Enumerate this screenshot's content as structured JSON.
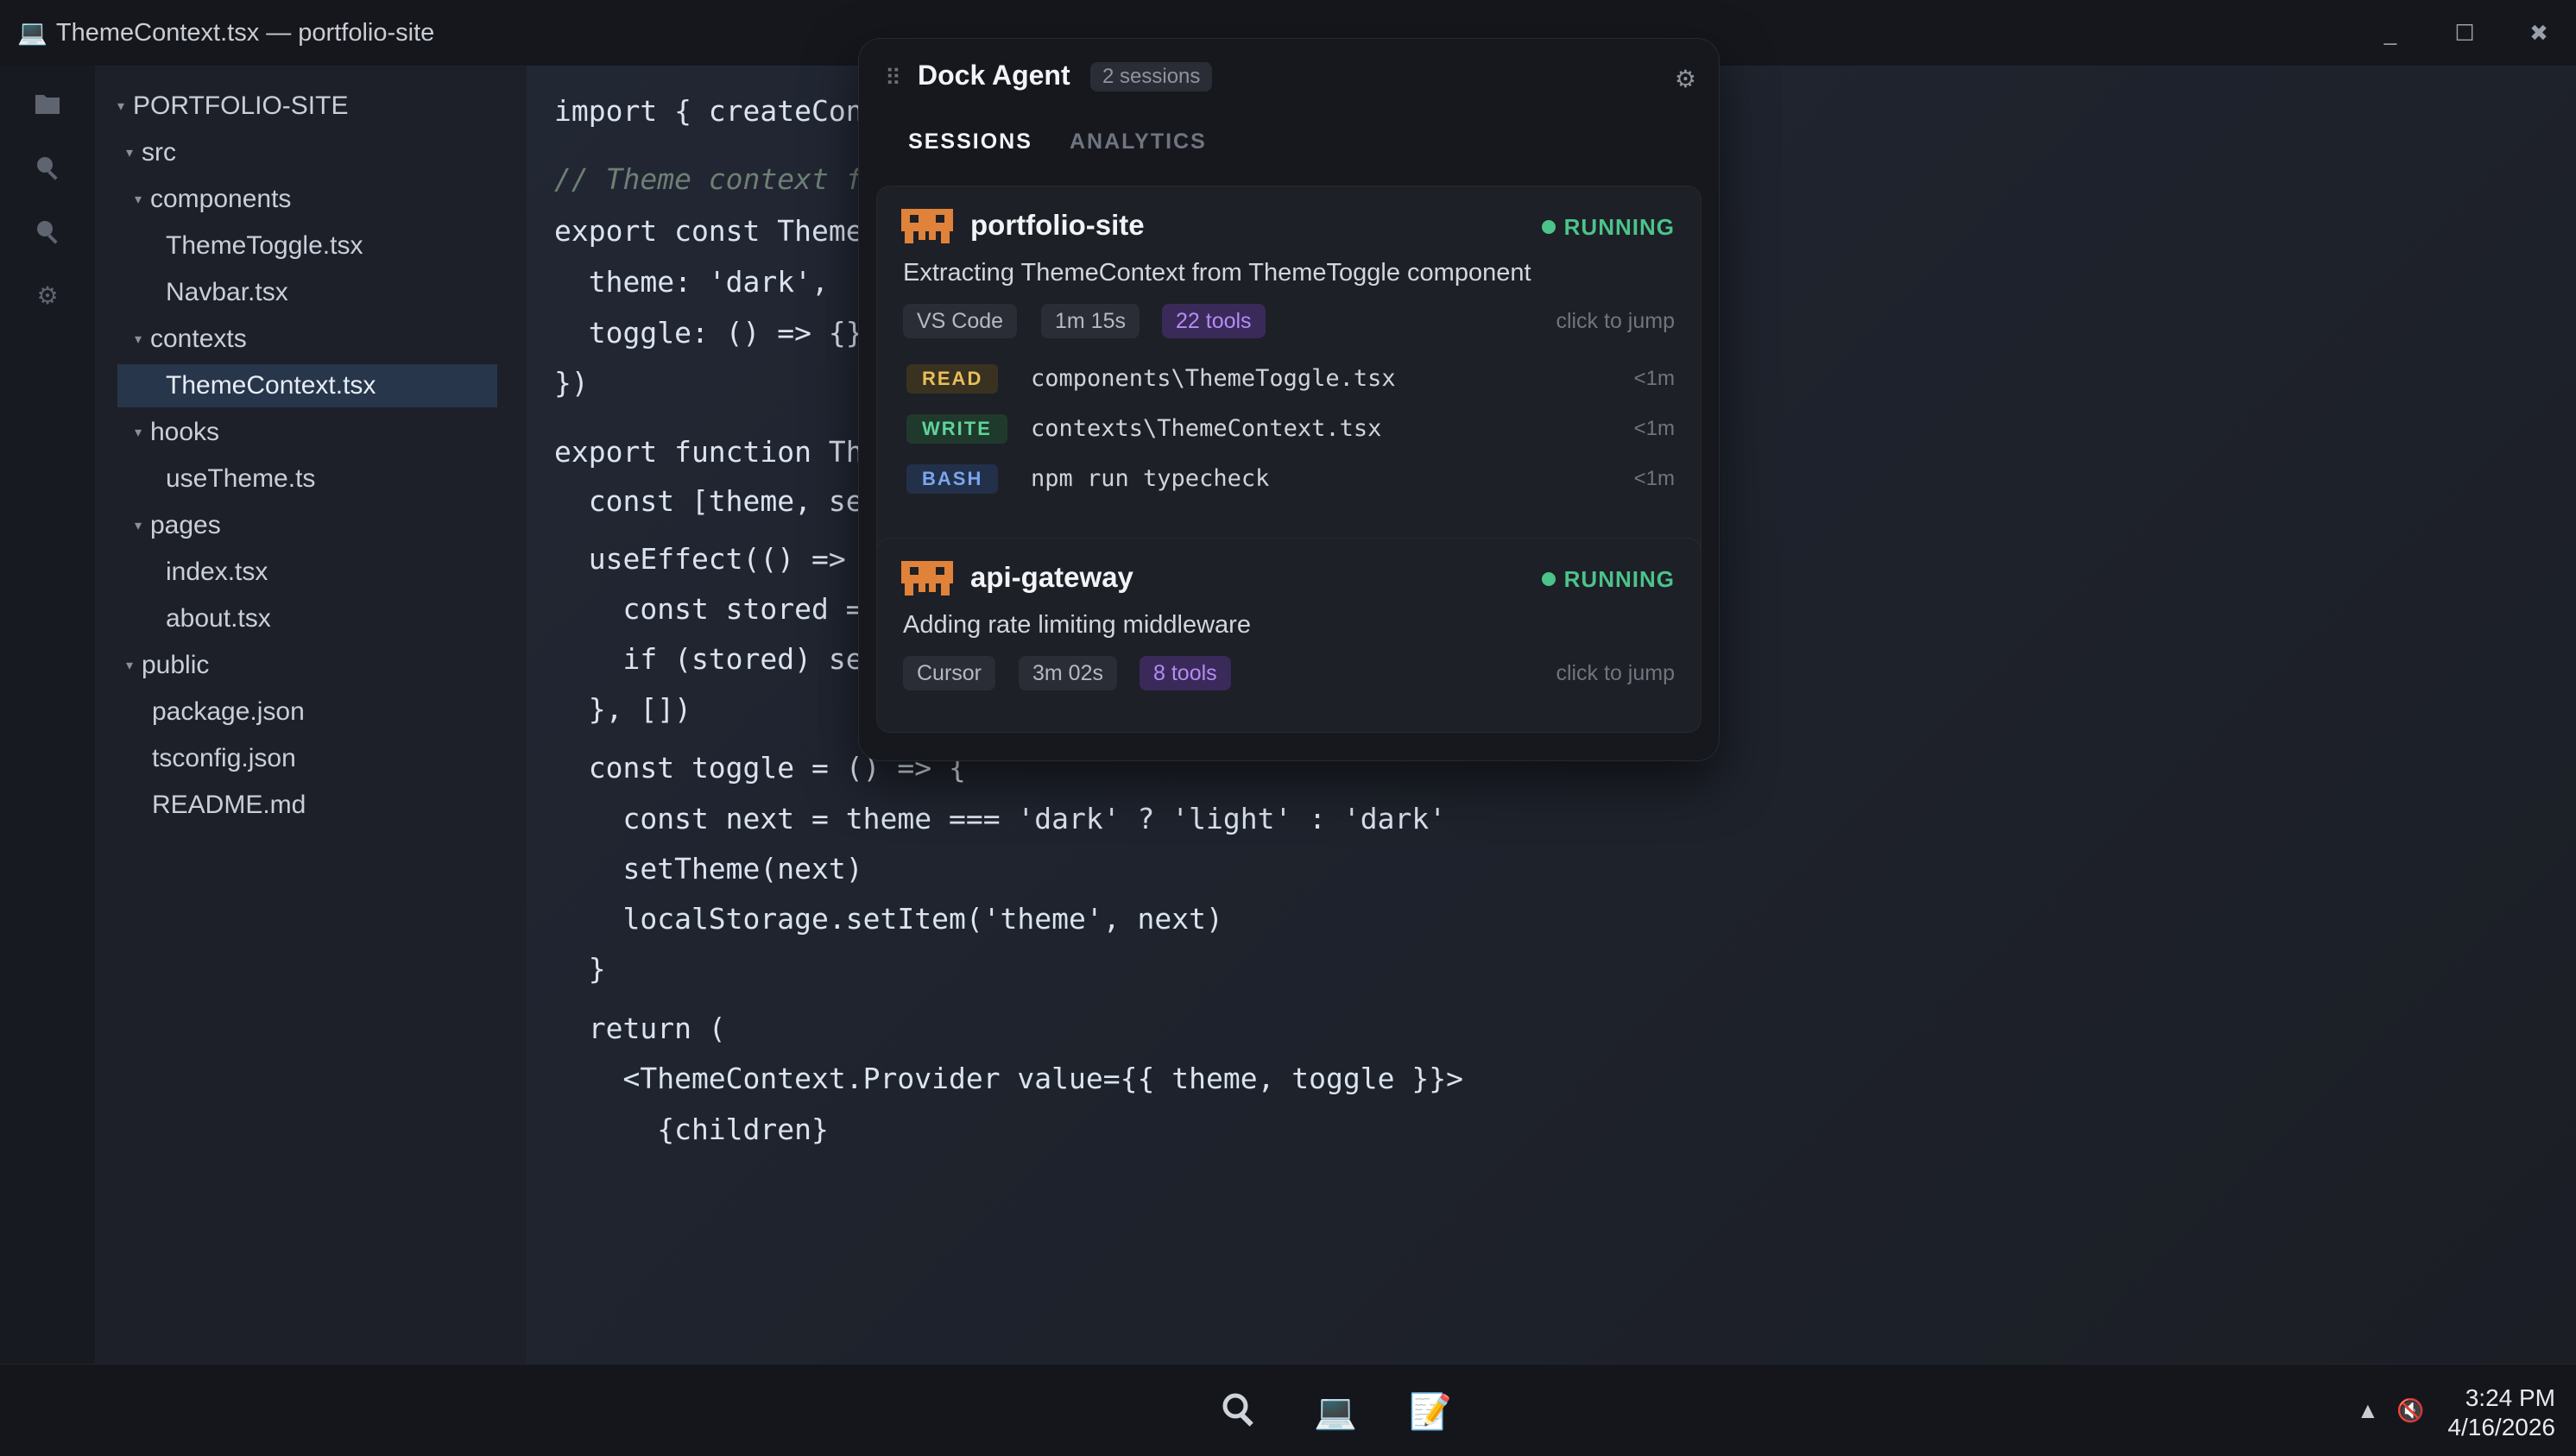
{
  "window": {
    "title": "ThemeContext.tsx — portfolio-site",
    "icon": "terminal-icon",
    "controls": [
      "_",
      "☐",
      "✖"
    ]
  },
  "activity_bar": [
    "files-icon",
    "search-icon",
    "search-icon",
    "gear-icon"
  ],
  "explorer": {
    "root": "PORTFOLIO-SITE",
    "items": [
      {
        "label": "src"
      },
      {
        "label": "components"
      },
      {
        "label": "ThemeToggle.tsx"
      },
      {
        "label": "Navbar.tsx"
      },
      {
        "label": "contexts"
      },
      {
        "label": "ThemeContext.tsx"
      },
      {
        "label": "hooks"
      },
      {
        "label": "useTheme.ts"
      },
      {
        "label": "pages"
      },
      {
        "label": "index.tsx"
      },
      {
        "label": "about.tsx"
      },
      {
        "label": "public"
      },
      {
        "label": "package.json"
      },
      {
        "label": "tsconfig.json"
      },
      {
        "label": "README.md"
      }
    ],
    "selected": "ThemeContext.tsx"
  },
  "editor": {
    "lines": [
      "import { createCon",
      "// Theme context f",
      "export const Theme",
      "  theme: 'dark',",
      "  toggle: () => {}",
      "})",
      "export function Th",
      "  const [theme, se",
      "  useEffect(() =>",
      "    const stored =",
      "    if (stored) se",
      "  }, [])",
      "  const toggle = () => {",
      "    const next = theme === 'dark' ? 'light' : 'dark'",
      "    setTheme(next)",
      "    localStorage.setItem('theme', next)",
      "  }",
      "  return (",
      "    <ThemeContext.Provider value={{ theme, toggle }}>",
      "      {children}"
    ]
  },
  "dock": {
    "title": "Dock Agent",
    "session_count": "2 sessions",
    "settings_icon": "gear-icon",
    "tabs": [
      "SESSIONS",
      "ANALYTICS"
    ],
    "active_tab": "SESSIONS",
    "sessions": [
      {
        "project": "portfolio-site",
        "status": "RUNNING",
        "task": "Extracting ThemeContext from ThemeToggle component",
        "editor": "VS Code",
        "duration": "1m 15s",
        "tools": "22 tools",
        "jump": "click to jump",
        "log": [
          {
            "kind": "READ",
            "path": "components\\ThemeToggle.tsx",
            "time": "<1m"
          },
          {
            "kind": "WRITE",
            "path": "contexts\\ThemeContext.tsx",
            "time": "<1m"
          },
          {
            "kind": "BASH",
            "path": "npm run typecheck",
            "time": "<1m"
          }
        ]
      },
      {
        "project": "api-gateway",
        "status": "RUNNING",
        "task": "Adding rate limiting middleware",
        "editor": "Cursor",
        "duration": "3m 02s",
        "tools": "8 tools",
        "jump": "click to jump"
      }
    ],
    "colors": {
      "running": "#4cc38a",
      "tools_chip": "#b58cf2",
      "mascot": "#e0823a"
    }
  },
  "taskbar": {
    "apps": [
      "search-icon",
      "terminal-icon",
      "notepad-icon"
    ],
    "tray": [
      "wifi-icon",
      "speaker-muted-icon"
    ],
    "time": "3:24 PM",
    "date": "4/16/2026"
  }
}
